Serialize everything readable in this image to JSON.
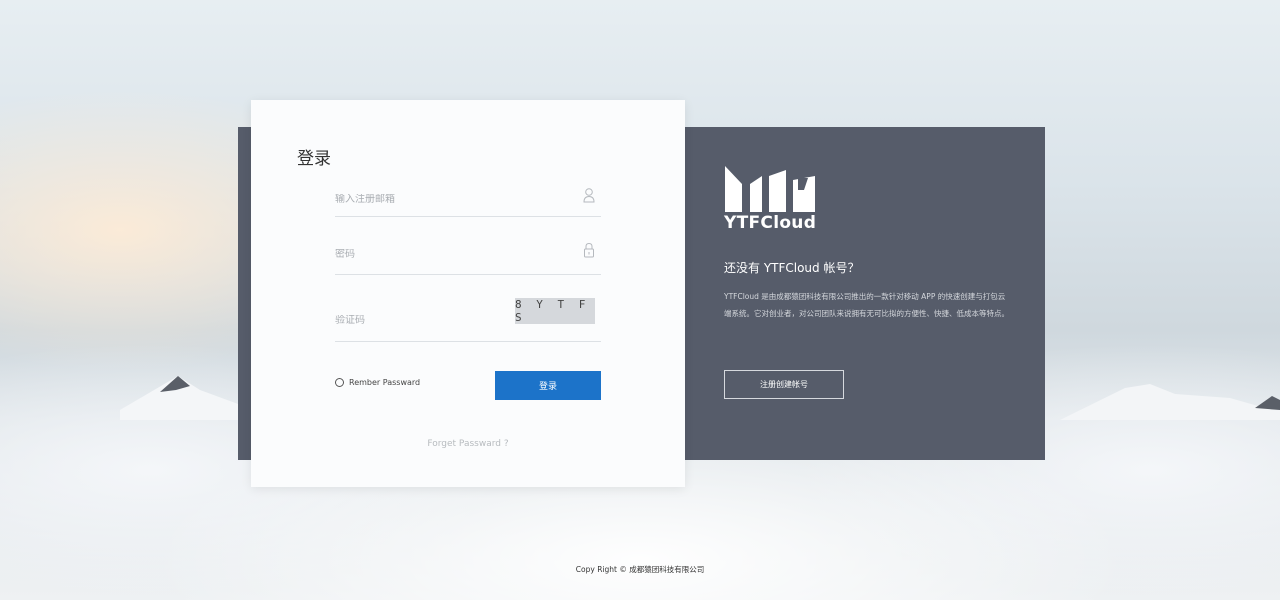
{
  "login": {
    "title": "登录",
    "email_placeholder": "输入注册邮箱",
    "password_placeholder": "密码",
    "captcha_placeholder": "验证码",
    "captcha_code": "8 Y T F S",
    "remember_label": "Rember Passward",
    "submit_label": "登录",
    "forget_label": "Forget Passward ?"
  },
  "promo": {
    "logo_text": "YTFCloud",
    "heading": "还没有 YTFCloud 帐号？",
    "description": "YTFCloud 是由成都猿团科技有限公司推出的一款针对移动 APP 的快速创建与打包云端系统。它对创业者，对公司团队来说拥有无可比拟的方便性、快捷、低成本等特点。",
    "register_label": "注册创建帐号"
  },
  "footer": {
    "copyright": "Copy Right ©  成都猿团科技有限公司"
  },
  "colors": {
    "primary_button": "#1c73c9",
    "dark_panel": "#565c6a"
  },
  "icons": {
    "email_field": "user-icon",
    "password_field": "lock-icon"
  }
}
